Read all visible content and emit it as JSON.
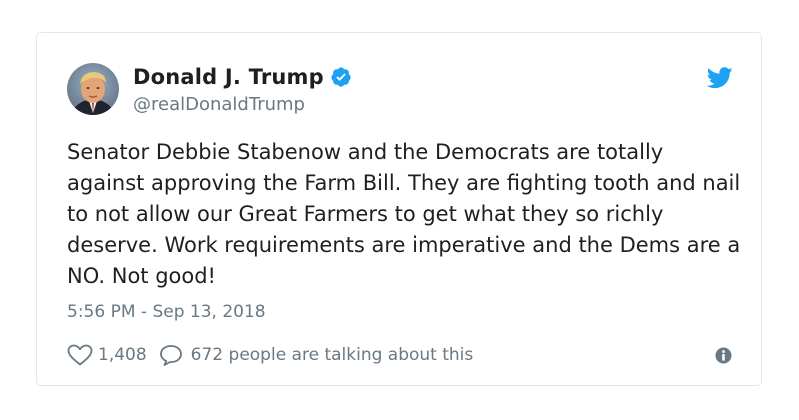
{
  "author": {
    "display_name": "Donald J. Trump",
    "handle": "@realDonaldTrump",
    "verified_icon": "verified-badge-icon",
    "avatar": "avatar-photo"
  },
  "tweet": {
    "text": "Senator Debbie Stabenow and the Democrats are totally against approving the Farm Bill. They are fighting tooth and nail to not allow our Great Farmers to get what they so richly deserve. Work requirements are imperative and the Dems are a NO. Not good!",
    "timestamp": "5:56 PM - Sep 13, 2018"
  },
  "actions": {
    "like_count": "1,408",
    "reply_text": "672 people are talking about this"
  },
  "colors": {
    "twitter_blue": "#1da1f2",
    "text_primary": "#1c2022",
    "text_secondary": "#697882",
    "border": "#e1e8ed"
  }
}
